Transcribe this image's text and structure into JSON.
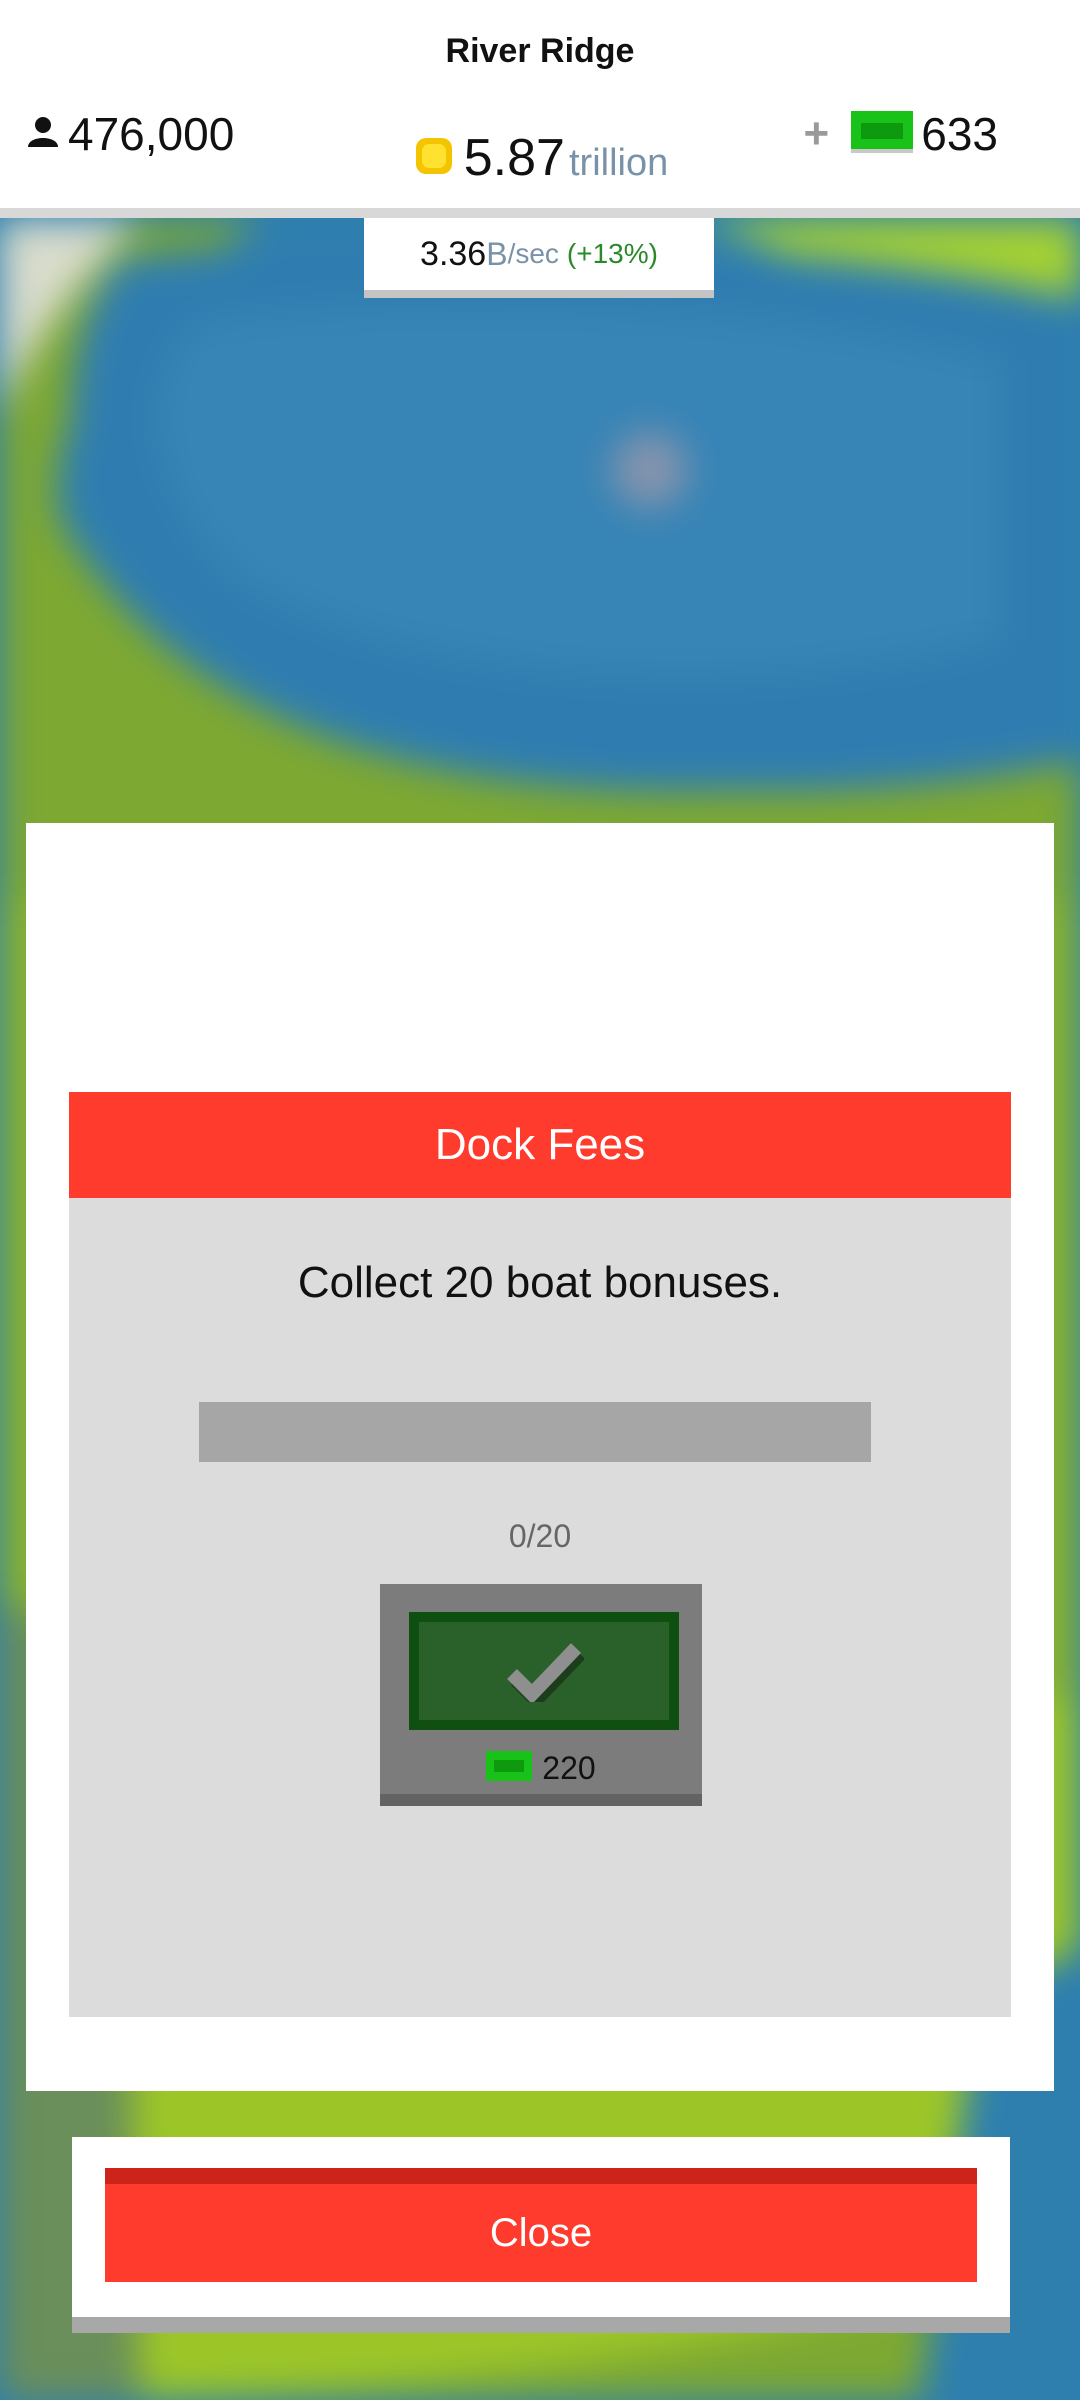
{
  "header": {
    "city_name": "River Ridge",
    "population": "476,000",
    "money_value": "5.87",
    "money_unit": "trillion",
    "cash": "633",
    "plus_label": "+",
    "rate_value": "3.36",
    "rate_unit": "B",
    "rate_per": "/sec",
    "rate_bonus": "(+13%)"
  },
  "goal": {
    "title": "Dock Fees",
    "description": "Collect 20 boat bonuses.",
    "progress_text": "0/20",
    "progress_fraction": 0,
    "reward_amount": "220"
  },
  "close_label": "Close",
  "icons": {
    "population": "person-icon",
    "money": "coin-icon",
    "cash": "cash-bill-icon",
    "claim": "checkmark-icon"
  },
  "colors": {
    "accent_red": "#ff3b2e",
    "cash_green": "#19c219",
    "coin_gold": "#f5c400",
    "claim_dark_green": "#0f4f0f"
  }
}
